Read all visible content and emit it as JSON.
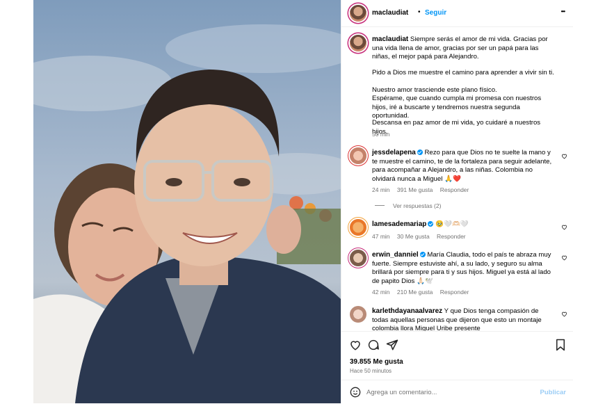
{
  "post": {
    "username": "maclaudiat",
    "follow_label": "Seguir",
    "separator": "•",
    "more_label": "•••"
  },
  "caption": {
    "username": "maclaudiat",
    "p1": "Siempre serás el amor de mi vida. Gracias por una vida llena de amor, gracias por ser un papá para las niñas, el mejor papá para Alejandro.",
    "p2": "Pido a Dios me muestre el camino para aprender a vivir sin ti.",
    "p3a": "Nuestro amor trasciende este plano físico.",
    "p3b": "Espérame, que cuando cumpla mi promesa con nuestros hijos, iré a buscarte y tendremos nuestra segunda oportunidad.",
    "p4": "Descansa en paz amor de mi vida, yo cuidaré a nuestros hijos.",
    "time": "50 min"
  },
  "comments": [
    {
      "username": "jessdelapena",
      "text": "Rezo para que Dios no te suelte la mano y te muestre el camino, te de la fortaleza para seguir adelante, para acompañar a Alejandro, a las niñas. Colombia no olvidará nunca a Miguel 🙏❤️",
      "time": "24 min",
      "likes": "391 Me gusta",
      "reply": "Responder",
      "view_replies": "Ver respuestas (2)"
    },
    {
      "username": "lamesademariap",
      "text": "🥹🤍🫶🏻🤍",
      "time": "47 min",
      "likes": "30 Me gusta",
      "reply": "Responder"
    },
    {
      "username": "erwin_danniel",
      "text": "María Claudia, todo el país te abraza muy fuerte. Siempre estuviste ahí, a su lado, y seguro su alma brillará por siempre para ti y sus hijos. Miguel ya está al lado de papito Dios 🙏🏻🕊️",
      "time": "42 min",
      "likes": "210 Me gusta",
      "reply": "Responder"
    },
    {
      "username": "karlethdayanaalvarez",
      "text": "Y que Dios tenga compasión de todas aquellas personas que dijeron que esto un montaje colombia llora Miguel Uribe presente"
    }
  ],
  "stats": {
    "likes": "39.855 Me gusta",
    "time": "Hace 50 minutos"
  },
  "add_comment": {
    "placeholder": "Agrega un comentario...",
    "publish": "Publicar"
  },
  "icons": {
    "like": "heart-icon",
    "comment": "comment-icon",
    "share": "send-icon",
    "save": "bookmark-icon",
    "emoji": "emoji-icon"
  }
}
